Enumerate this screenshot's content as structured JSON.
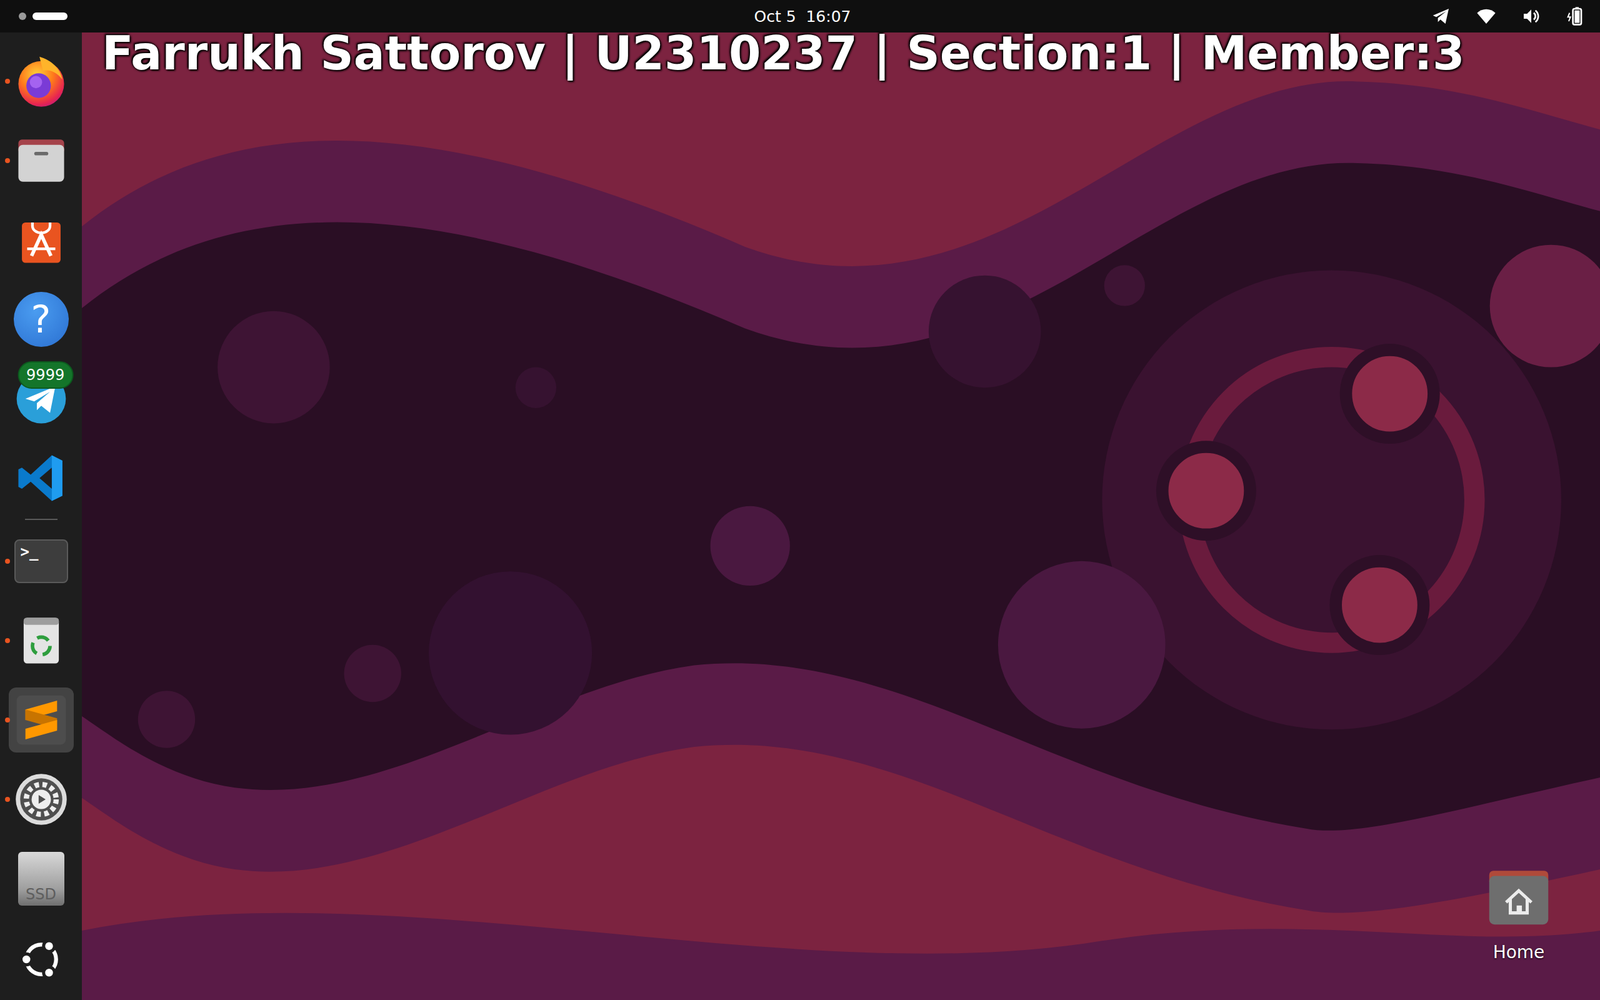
{
  "topbar": {
    "workspaces": [
      {
        "selected": false
      },
      {
        "selected": true
      }
    ],
    "clock": "Oct 5  16:07"
  },
  "overlay": {
    "text": "Farrukh Sattorov | U2310237 | Section:1 | Member:3"
  },
  "dock": {
    "pinned": [
      {
        "kind": "firefox",
        "running": true,
        "selected": false
      },
      {
        "kind": "files",
        "running": true,
        "selected": false
      },
      {
        "kind": "appcenter",
        "running": false,
        "selected": false
      },
      {
        "kind": "help",
        "running": false,
        "selected": false,
        "glyph": "?"
      },
      {
        "kind": "telegram",
        "running": false,
        "selected": false,
        "badge": "9999"
      },
      {
        "kind": "vscode",
        "running": false,
        "selected": false
      }
    ],
    "others": [
      {
        "kind": "terminal",
        "running": true,
        "selected": false,
        "glyph": ">_"
      },
      {
        "kind": "trash",
        "running": true,
        "selected": false
      },
      {
        "kind": "sublime",
        "running": true,
        "selected": true
      },
      {
        "kind": "settings",
        "running": true,
        "selected": false
      },
      {
        "kind": "ssd",
        "running": false,
        "selected": false,
        "label": "SSD"
      }
    ]
  },
  "desktop": {
    "icons": [
      {
        "label": "Home"
      }
    ]
  }
}
